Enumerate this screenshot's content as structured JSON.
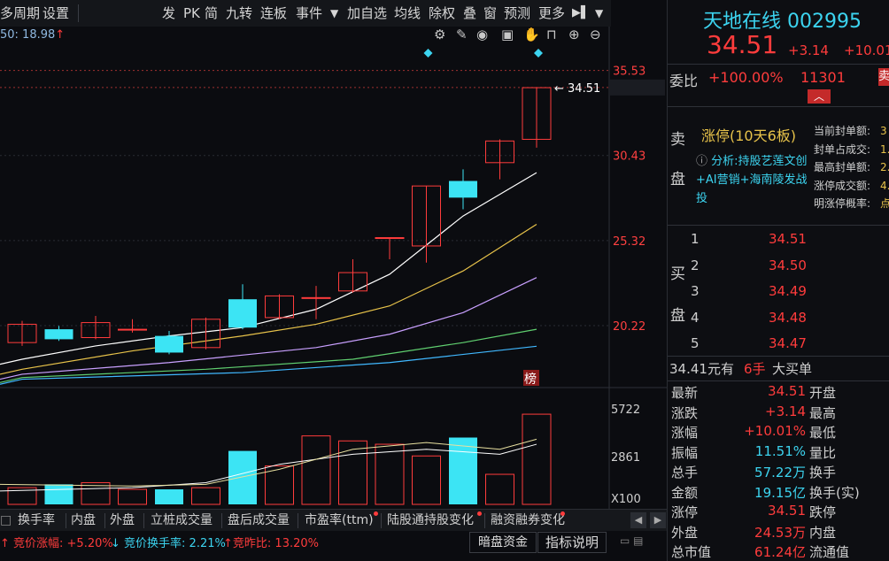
{
  "toolbar": {
    "items": [
      "多周期",
      "设置",
      "发",
      "PK",
      "简",
      "九转",
      "连板",
      "事件",
      "▼",
      "加自选",
      "均线",
      "除权",
      "叠",
      "窗",
      "预测",
      "更多",
      "▶▌",
      "▼"
    ]
  },
  "ma_label": "50: 18.98",
  "price_axis": [
    "35.53",
    "34.51",
    "30.43",
    "25.32",
    "20.22"
  ],
  "vol_axis": [
    "5722",
    "2861",
    "X100"
  ],
  "last_price_tag": "34.51",
  "bang_label": "榜",
  "chart_data": {
    "type": "candlestick",
    "candles": [
      {
        "open": 19.2,
        "close": 20.3,
        "high": 20.5,
        "low": 19.0,
        "up": true
      },
      {
        "open": 20.0,
        "close": 19.4,
        "high": 20.2,
        "low": 19.3,
        "up": false
      },
      {
        "open": 19.5,
        "close": 20.4,
        "high": 20.8,
        "low": 19.4,
        "up": true
      },
      {
        "open": 20.0,
        "close": 20.0,
        "high": 20.6,
        "low": 19.8,
        "up": true
      },
      {
        "open": 19.6,
        "close": 18.6,
        "high": 19.9,
        "low": 18.5,
        "up": false
      },
      {
        "open": 18.9,
        "close": 20.6,
        "high": 20.7,
        "low": 18.8,
        "up": true
      },
      {
        "open": 21.8,
        "close": 20.1,
        "high": 22.7,
        "low": 20.0,
        "up": false
      },
      {
        "open": 20.7,
        "close": 22.0,
        "high": 22.1,
        "low": 20.6,
        "up": true
      },
      {
        "open": 21.9,
        "close": 21.9,
        "high": 22.6,
        "low": 20.6,
        "up": true
      },
      {
        "open": 22.3,
        "close": 23.4,
        "high": 24.2,
        "low": 22.2,
        "up": true
      },
      {
        "open": 25.5,
        "close": 25.5,
        "high": 25.5,
        "low": 24.2,
        "up": true
      },
      {
        "open": 25.0,
        "close": 28.6,
        "high": 28.6,
        "low": 24.0,
        "up": true
      },
      {
        "open": 28.9,
        "close": 27.9,
        "high": 29.6,
        "low": 27.2,
        "up": false
      },
      {
        "open": 30.0,
        "close": 31.3,
        "high": 31.4,
        "low": 29.0,
        "up": true
      },
      {
        "open": 31.4,
        "close": 34.5,
        "high": 34.5,
        "low": 30.9,
        "up": true
      }
    ],
    "volumes": [
      {
        "v": 1000,
        "up": true
      },
      {
        "v": 1200,
        "up": false
      },
      {
        "v": 1300,
        "up": true
      },
      {
        "v": 900,
        "up": true
      },
      {
        "v": 900,
        "up": false
      },
      {
        "v": 1000,
        "up": true
      },
      {
        "v": 3200,
        "up": false
      },
      {
        "v": 2300,
        "up": true
      },
      {
        "v": 4100,
        "up": true
      },
      {
        "v": 3800,
        "up": true
      },
      {
        "v": 3600,
        "up": true
      },
      {
        "v": 2900,
        "up": true
      },
      {
        "v": 4000,
        "up": false
      },
      {
        "v": 1800,
        "up": true
      },
      {
        "v": 5400,
        "up": true
      }
    ],
    "ylim": [
      16.5,
      37
    ],
    "vol_ylim": [
      0,
      5722
    ]
  },
  "tabs": [
    "换手率",
    "内盘",
    "外盘",
    "立桩成交量",
    "盘后成交量",
    "市盈率(ttm)",
    "陆股通持股变化",
    "融资融券变化"
  ],
  "status": {
    "auction_change": "竞价涨幅: +5.20%",
    "auction_turnover": "竞价换手率: 2.21%",
    "auction_ratio": "竞昨比: 13.20%",
    "dark_funds": "暗盘资金",
    "indicator_help": "指标说明"
  },
  "quote": {
    "name_code": "天地在线 002995",
    "price": "34.51",
    "change": "+3.14",
    "change_pct": "+10.01",
    "weibi_label": "委比",
    "weibi": "+100.00%",
    "weicha": "11301",
    "sell_side_label": "卖",
    "sell_label_chars": [
      "卖",
      "盘"
    ],
    "limit_title": "涨停(10天6板)",
    "analysis": "分析:持股艺莲文创+AI营销+海南陵发战投",
    "limit_stats": [
      "当前封单额:",
      "封单占成交:",
      "最高封单额:",
      "涨停成交额:",
      "明涨停概率:"
    ],
    "limit_stats_vals": [
      "3",
      "1.",
      "2.",
      "4.",
      "点"
    ],
    "buy_label_chars": [
      "买",
      "盘"
    ],
    "bids": [
      {
        "n": "1",
        "p": "34.51"
      },
      {
        "n": "2",
        "p": "34.50"
      },
      {
        "n": "3",
        "p": "34.49"
      },
      {
        "n": "4",
        "p": "34.48"
      },
      {
        "n": "5",
        "p": "34.47"
      }
    ],
    "big_order": {
      "price": "34.41元有",
      "lots": "6手",
      "text": "大买单"
    },
    "stats": [
      {
        "l": "最新",
        "v": "34.51",
        "r": "开盘"
      },
      {
        "l": "涨跌",
        "v": "+3.14",
        "r": "最高"
      },
      {
        "l": "涨幅",
        "v": "+10.01%",
        "r": "最低"
      },
      {
        "l": "振幅",
        "v": "11.51%",
        "r": "量比"
      },
      {
        "l": "总手",
        "v": "57.22万",
        "r": "换手"
      },
      {
        "l": "金额",
        "v": "19.15亿",
        "r": "换手(实)"
      },
      {
        "l": "涨停",
        "v": "34.51",
        "r": "跌停"
      },
      {
        "l": "外盘",
        "v": "24.53万",
        "r": "内盘"
      },
      {
        "l": "总市值",
        "v": "61.24亿",
        "r": "流通值"
      }
    ]
  },
  "colors": {
    "up": "#ff3c3c",
    "down": "#3ce4f4",
    "bg": "#0b0c10"
  }
}
